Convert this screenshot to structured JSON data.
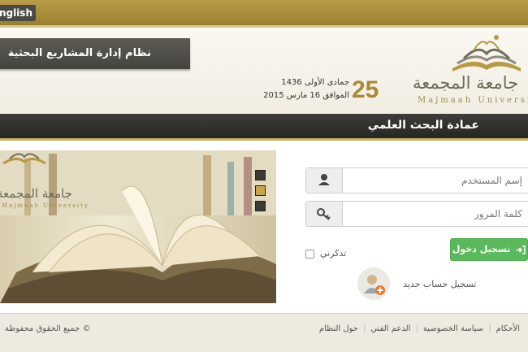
{
  "topbar": {
    "lang_label": "English"
  },
  "header": {
    "system_title": "نظام إدارة المشاريع البحثية",
    "date_day": "25",
    "date_hijri": "جمادى الأولى 1436",
    "date_gregorian": "الموافق 16 مارس 2015",
    "university_name": "جامعة المجمعة",
    "university_latin": "Majmaah University"
  },
  "deanship": {
    "title": "عمادة البحث العلمي"
  },
  "login": {
    "username_placeholder": "إسم المستخدم",
    "password_placeholder": "كلمة المرور",
    "login_label": "تسجيل دخول",
    "remember_label": "تذكرني",
    "register_label": "تسجيل حساب جديد"
  },
  "slider": {
    "logo_name": "جامعة المجمعة",
    "logo_latin": "Majmaah University",
    "slide_count": 3,
    "active_slide": 2
  },
  "footer": {
    "copyright": "جميع الحقوق محفوظة ©",
    "links": [
      "الأحكام",
      "سياسة الخصوصية",
      "الدعم الفني",
      "حول النظام"
    ]
  },
  "colors": {
    "gold": "#b99c47",
    "dark": "#2e2e2a",
    "green": "#5cb85c",
    "banner": "#4f4e48"
  },
  "icons": {
    "username": "user-icon",
    "password": "key-icon",
    "login": "sign-in-icon",
    "register": "add-user-icon",
    "logo": "open-book-logo-icon"
  }
}
